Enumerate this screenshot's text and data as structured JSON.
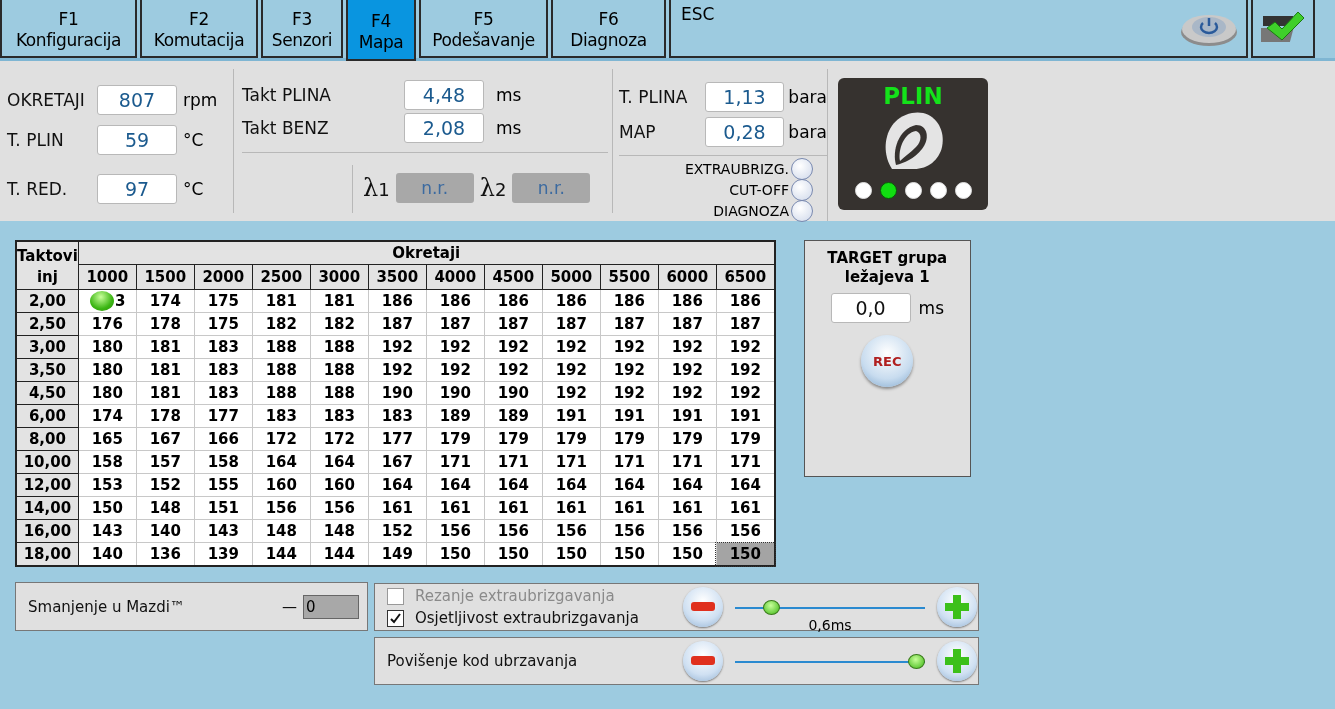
{
  "tabs": [
    {
      "key": "F1",
      "label": "Konfiguracija",
      "selected": false
    },
    {
      "key": "F2",
      "label": "Komutacija",
      "selected": false
    },
    {
      "key": "F3",
      "label": "Senzori",
      "selected": false
    },
    {
      "key": "F4",
      "label": "Mapa",
      "selected": true
    },
    {
      "key": "F5",
      "label": "Podešavanje",
      "selected": false
    },
    {
      "key": "F6",
      "label": "Diagnoza",
      "selected": false
    }
  ],
  "esc": "ESC",
  "sensors": [
    {
      "label": "OKRETAJI",
      "value": "807",
      "unit": "rpm"
    },
    {
      "label": "T. PLIN",
      "value": "59",
      "unit": "°C"
    },
    {
      "label": "T. RED.",
      "value": "97",
      "unit": "°C"
    }
  ],
  "injection": [
    {
      "label": "Takt PLINA",
      "value": "4,48",
      "unit": "ms"
    },
    {
      "label": "Takt BENZ",
      "value": "2,08",
      "unit": "ms"
    }
  ],
  "lambdas": [
    {
      "symbol": "λ",
      "index": "1",
      "value": "n.r."
    },
    {
      "symbol": "λ",
      "index": "2",
      "value": "n.r."
    }
  ],
  "pressure": [
    {
      "label": "T. PLINA",
      "value": "1,13",
      "unit": "bara"
    },
    {
      "label": "MAP",
      "value": "0,28",
      "unit": "bara"
    }
  ],
  "indicators": [
    {
      "label": "EXTRAUBRIZG.",
      "on": false
    },
    {
      "label": "CUT-OFF",
      "on": false
    },
    {
      "label": "DIAGNOZA",
      "on": false
    }
  ],
  "fuel_status": {
    "label": "PLIN",
    "dots": [
      {
        "selected": false
      },
      {
        "selected": true
      },
      {
        "selected": false
      },
      {
        "selected": false
      },
      {
        "selected": false
      }
    ]
  },
  "map_table": {
    "corner_top": "Taktovi",
    "corner_bottom": "inj",
    "group_header": "Okretaji",
    "columns": [
      "1000",
      "1500",
      "2000",
      "2500",
      "3000",
      "3500",
      "4000",
      "4500",
      "5000",
      "5500",
      "6000",
      "6500"
    ],
    "rows": [
      {
        "label": "2,00",
        "cells": [
          "3",
          "174",
          "175",
          "181",
          "181",
          "186",
          "186",
          "186",
          "186",
          "186",
          "186",
          "186"
        ],
        "cursor_first": true,
        "selected_last": false
      },
      {
        "label": "2,50",
        "cells": [
          "176",
          "178",
          "175",
          "182",
          "182",
          "187",
          "187",
          "187",
          "187",
          "187",
          "187",
          "187"
        ],
        "cursor_first": false,
        "selected_last": false
      },
      {
        "label": "3,00",
        "cells": [
          "180",
          "181",
          "183",
          "188",
          "188",
          "192",
          "192",
          "192",
          "192",
          "192",
          "192",
          "192"
        ],
        "cursor_first": false,
        "selected_last": false
      },
      {
        "label": "3,50",
        "cells": [
          "180",
          "181",
          "183",
          "188",
          "188",
          "192",
          "192",
          "192",
          "192",
          "192",
          "192",
          "192"
        ],
        "cursor_first": false,
        "selected_last": false
      },
      {
        "label": "4,50",
        "cells": [
          "180",
          "181",
          "183",
          "188",
          "188",
          "190",
          "190",
          "190",
          "192",
          "192",
          "192",
          "192"
        ],
        "cursor_first": false,
        "selected_last": false
      },
      {
        "label": "6,00",
        "cells": [
          "174",
          "178",
          "177",
          "183",
          "183",
          "183",
          "189",
          "189",
          "191",
          "191",
          "191",
          "191"
        ],
        "cursor_first": false,
        "selected_last": false
      },
      {
        "label": "8,00",
        "cells": [
          "165",
          "167",
          "166",
          "172",
          "172",
          "177",
          "179",
          "179",
          "179",
          "179",
          "179",
          "179"
        ],
        "cursor_first": false,
        "selected_last": false
      },
      {
        "label": "10,00",
        "cells": [
          "158",
          "157",
          "158",
          "164",
          "164",
          "167",
          "171",
          "171",
          "171",
          "171",
          "171",
          "171"
        ],
        "cursor_first": false,
        "selected_last": false
      },
      {
        "label": "12,00",
        "cells": [
          "153",
          "152",
          "155",
          "160",
          "160",
          "164",
          "164",
          "164",
          "164",
          "164",
          "164",
          "164"
        ],
        "cursor_first": false,
        "selected_last": false
      },
      {
        "label": "14,00",
        "cells": [
          "150",
          "148",
          "151",
          "156",
          "156",
          "161",
          "161",
          "161",
          "161",
          "161",
          "161",
          "161"
        ],
        "cursor_first": false,
        "selected_last": false
      },
      {
        "label": "16,00",
        "cells": [
          "143",
          "140",
          "143",
          "148",
          "148",
          "152",
          "156",
          "156",
          "156",
          "156",
          "156",
          "156"
        ],
        "cursor_first": false,
        "selected_last": false
      },
      {
        "label": "18,00",
        "cells": [
          "140",
          "136",
          "139",
          "144",
          "144",
          "149",
          "150",
          "150",
          "150",
          "150",
          "150",
          "150"
        ],
        "cursor_first": false,
        "selected_last": true
      }
    ]
  },
  "target": {
    "title": "TARGET grupa ležajeva 1",
    "value": "0,0",
    "unit": "ms",
    "button": "REC"
  },
  "mazda": {
    "label": "Smanjenje u Mazdi™",
    "sign": "—",
    "value": "0"
  },
  "extra": {
    "options": [
      {
        "label": "Rezanje extraubrizgavanja",
        "checked": false,
        "disabled": true
      },
      {
        "label": "Osjetljivost extraubrizgavanja",
        "checked": true,
        "disabled": false
      }
    ],
    "level": 0.16,
    "reading": "0,6ms"
  },
  "acceleration": {
    "label": "Povišenje kod ubrzavanja",
    "level": 1.0
  }
}
